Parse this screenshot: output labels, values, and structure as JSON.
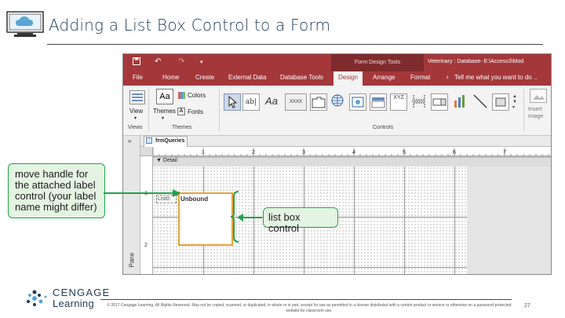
{
  "slide": {
    "title": "Adding a List Box Control to a Form",
    "page_number": "27",
    "copyright": "© 2017 Cengage Learning. All Rights Reserved. May not be copied, scanned, or duplicated, in whole or in part, except for use as permitted in a license distributed with a certain product or service or otherwise on a password-protected website for classroom use."
  },
  "logo": {
    "line1": "CENGAGE",
    "line2": "Learning"
  },
  "access": {
    "context_tab": "Form Design Tools",
    "window_title": "Veterinary : Database- E:\\Access3\\Mod",
    "menu": [
      "File",
      "Home",
      "Create",
      "External Data",
      "Database Tools",
      "Design",
      "Arrange",
      "Format"
    ],
    "tell_me": "Tell me what you want to do ..",
    "ribbon": {
      "view": "View",
      "themes": "Themes",
      "colors": "Colors",
      "fonts": "Fonts",
      "group_views": "Views",
      "group_themes": "Themes",
      "group_controls": "Controls",
      "insert_image": "Insert Image",
      "control_label": "Aa",
      "control_textbox": "ab|",
      "control_button": "XXXX",
      "control_xyz": "XYZ"
    },
    "form_tab": "frmQueries",
    "section": "Detail",
    "nav_label": "Pane",
    "label_control": "List0:",
    "listbox_text": "Unbound",
    "ruler_numbers": [
      "1",
      "2",
      "3",
      "4",
      "5",
      "6",
      "7"
    ],
    "vruler_numbers": [
      "1",
      "2"
    ]
  },
  "callouts": {
    "left": "move handle for the attached label control (your label name might differ)",
    "right": "list box control"
  },
  "colors": {
    "access_red": "#a4373a",
    "callout_green": "#22a24a",
    "listbox_orange": "#e5a339"
  }
}
